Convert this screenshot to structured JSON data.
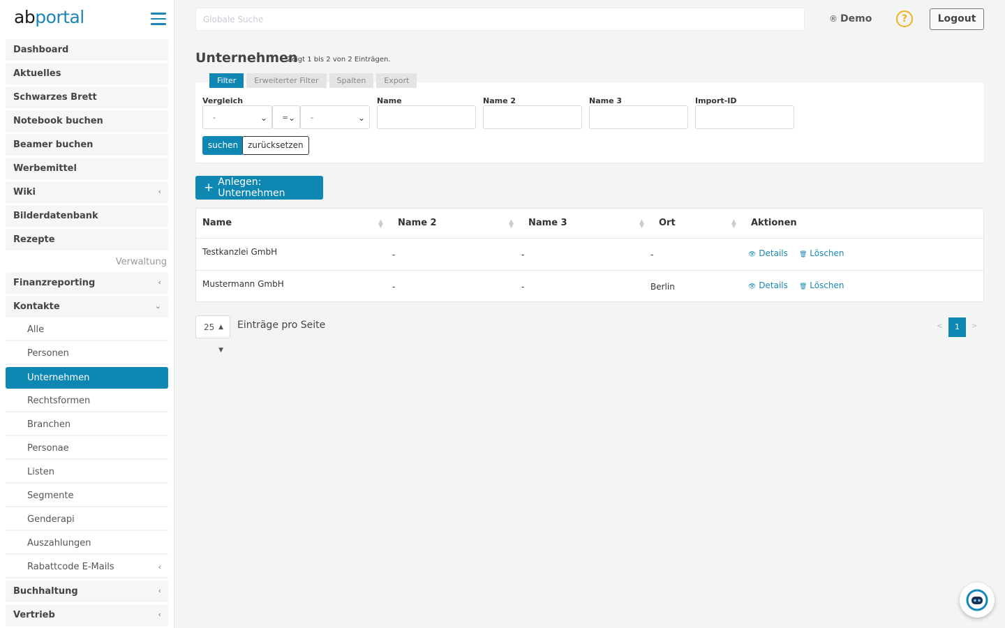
{
  "brand": {
    "prefix": "ab",
    "suffix": "portal"
  },
  "sidebar": {
    "items": [
      {
        "label": "Dashboard"
      },
      {
        "label": "Aktuelles"
      },
      {
        "label": "Schwarzes Brett"
      },
      {
        "label": "Notebook buchen"
      },
      {
        "label": "Beamer buchen"
      },
      {
        "label": "Werbemittel"
      },
      {
        "label": "Wiki",
        "chevron": "‹"
      },
      {
        "label": "Bilderdatenbank"
      },
      {
        "label": "Rezepte"
      }
    ],
    "section_label": "Verwaltung",
    "admin_items": [
      {
        "label": "Finanzreporting",
        "chevron": "‹"
      },
      {
        "label": "Kontakte",
        "chevron": "⌄"
      }
    ],
    "sub_items": [
      {
        "label": "Alle"
      },
      {
        "label": "Personen"
      },
      {
        "label": "Unternehmen",
        "active": true
      },
      {
        "label": "Rechtsformen"
      },
      {
        "label": "Branchen"
      },
      {
        "label": "Personae"
      },
      {
        "label": "Listen"
      },
      {
        "label": "Segmente"
      },
      {
        "label": "Genderapi"
      },
      {
        "label": "Auszahlungen"
      },
      {
        "label": "Rabattcode E-Mails",
        "chevron": "‹"
      }
    ],
    "bottom_items": [
      {
        "label": "Buchhaltung",
        "chevron": "‹"
      },
      {
        "label": "Vertrieb",
        "chevron": "‹"
      }
    ]
  },
  "header": {
    "search_placeholder": "Globale Suche",
    "user_icon": "®",
    "user": "Demo",
    "help": "?",
    "logout": "Logout"
  },
  "page": {
    "title": "Unternehmen",
    "subtitle": "Zeigt 1 bis 2 von 2 Einträgen."
  },
  "tabs": [
    "Filter",
    "Erweiterter Filter",
    "Spalten",
    "Export"
  ],
  "filter": {
    "labels": {
      "vergleich": "Vergleich",
      "name": "Name",
      "name2": "Name 2",
      "name3": "Name 3",
      "import_id": "Import-ID"
    },
    "select1": "-",
    "select2": "=",
    "select3": "-",
    "search_button": "suchen",
    "reset_button": "zurücksetzen"
  },
  "create_button": {
    "icon": "+",
    "label": "Anlegen: Unternehmen"
  },
  "table": {
    "columns": [
      "Name",
      "Name 2",
      "Name 3",
      "Ort",
      "Aktionen"
    ],
    "rows": [
      {
        "name": "Testkanzlei GmbH",
        "name2": "-",
        "name3": "-",
        "ort": "-"
      },
      {
        "name": "Mustermann GmbH",
        "name2": "-",
        "name3": "-",
        "ort": "Berlin"
      }
    ],
    "action_details": "Details",
    "action_delete": "Löschen",
    "details_icon": "👁",
    "delete_icon": "🗑"
  },
  "pagination": {
    "per_page": "25",
    "per_page_label": "Einträge pro Seite",
    "prev": "<",
    "current": "1",
    "next": ">"
  },
  "colors": {
    "accent": "#0f87b3",
    "help": "#f0b323"
  }
}
